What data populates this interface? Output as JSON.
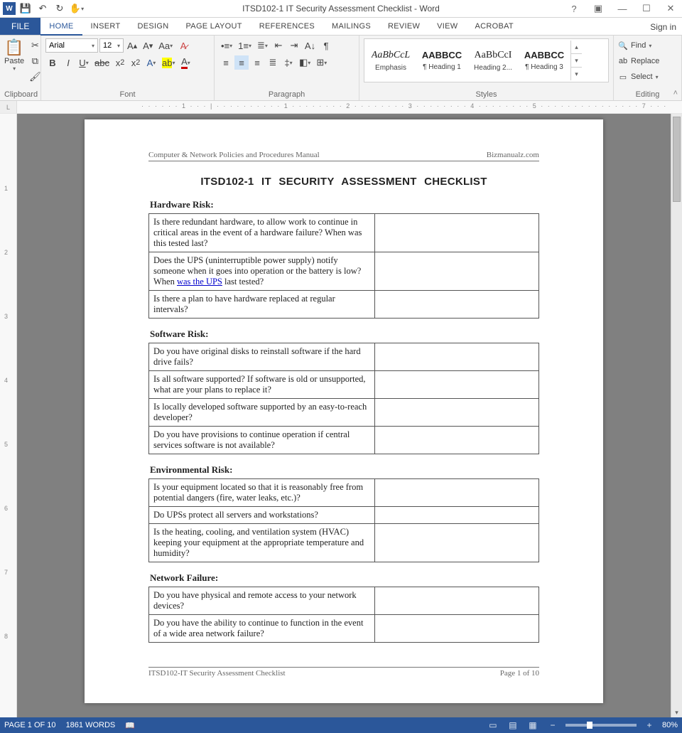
{
  "titlebar": {
    "app_title": "ITSD102-1 IT Security Assessment Checklist - Word",
    "signin": "Sign in"
  },
  "tabs": {
    "file": "FILE",
    "home": "HOME",
    "insert": "INSERT",
    "design": "DESIGN",
    "pagelayout": "PAGE LAYOUT",
    "references": "REFERENCES",
    "mailings": "MAILINGS",
    "review": "REVIEW",
    "view": "VIEW",
    "acrobat": "ACROBAT"
  },
  "ribbon": {
    "clipboard": {
      "label": "Clipboard",
      "paste": "Paste"
    },
    "font": {
      "label": "Font",
      "name": "Arial",
      "size": "12"
    },
    "paragraph": {
      "label": "Paragraph"
    },
    "styles": {
      "label": "Styles",
      "items": [
        {
          "preview": "AaBbCcL",
          "name": "Emphasis"
        },
        {
          "preview": "AABBCC",
          "name": "¶ Heading 1"
        },
        {
          "preview": "AaBbCcI",
          "name": "Heading 2..."
        },
        {
          "preview": "AABBCC",
          "name": "¶ Heading 3"
        }
      ]
    },
    "editing": {
      "label": "Editing",
      "find": "Find",
      "replace": "Replace",
      "select": "Select"
    }
  },
  "ruler": {
    "h": "· · · · · · 1 · · · | · · · · · · · · · · 1 · · · · · · · · 2 · · · · · · · · 3 · · · · · · · · 4 · · · · · · · · 5 · · · · · · · · · · · · · · · 7 · · ·"
  },
  "document": {
    "header_left": "Computer & Network Policies and Procedures Manual",
    "header_right": "Bizmanualz.com",
    "title": "ITSD102-1   IT SECURITY ASSESSMENT CHECKLIST",
    "sections": [
      {
        "heading": "Hardware Risk:",
        "rows": [
          "Is there redundant hardware, to allow work to continue in critical areas in the event of a hardware failure?  When was this tested last?",
          "Does the UPS (uninterruptible power supply) notify someone when it goes into operation or the battery is low? When <span class='hyper'>was the UPS</span> last tested?",
          "Is there a plan to have hardware replaced at regular intervals?"
        ]
      },
      {
        "heading": "Software Risk:",
        "rows": [
          "Do you have original disks to reinstall software if the hard drive fails?",
          "Is all software supported?  If software is old or unsupported, what are your plans to replace it?",
          "Is locally developed software supported by an easy-to-reach developer?",
          "Do you have provisions to continue operation if central services software is not available?"
        ]
      },
      {
        "heading": "Environmental Risk:",
        "rows": [
          "Is your equipment located so that it is reasonably free from potential dangers (fire, water leaks, etc.)?",
          "Do UPSs protect all servers and workstations?",
          "Is the heating, cooling, and ventilation system (HVAC) keeping your equipment at the appropriate temperature and humidity?"
        ]
      },
      {
        "heading": "Network Failure:",
        "rows": [
          "Do you have physical and remote access to your network devices?",
          "Do you have the ability to continue to function in the event of a wide area network failure?"
        ]
      }
    ],
    "footer_left": "ITSD102-IT Security Assessment Checklist",
    "footer_right": "Page 1 of 10"
  },
  "statusbar": {
    "page": "PAGE 1 OF 10",
    "words": "1861 WORDS",
    "zoom": "80%"
  }
}
